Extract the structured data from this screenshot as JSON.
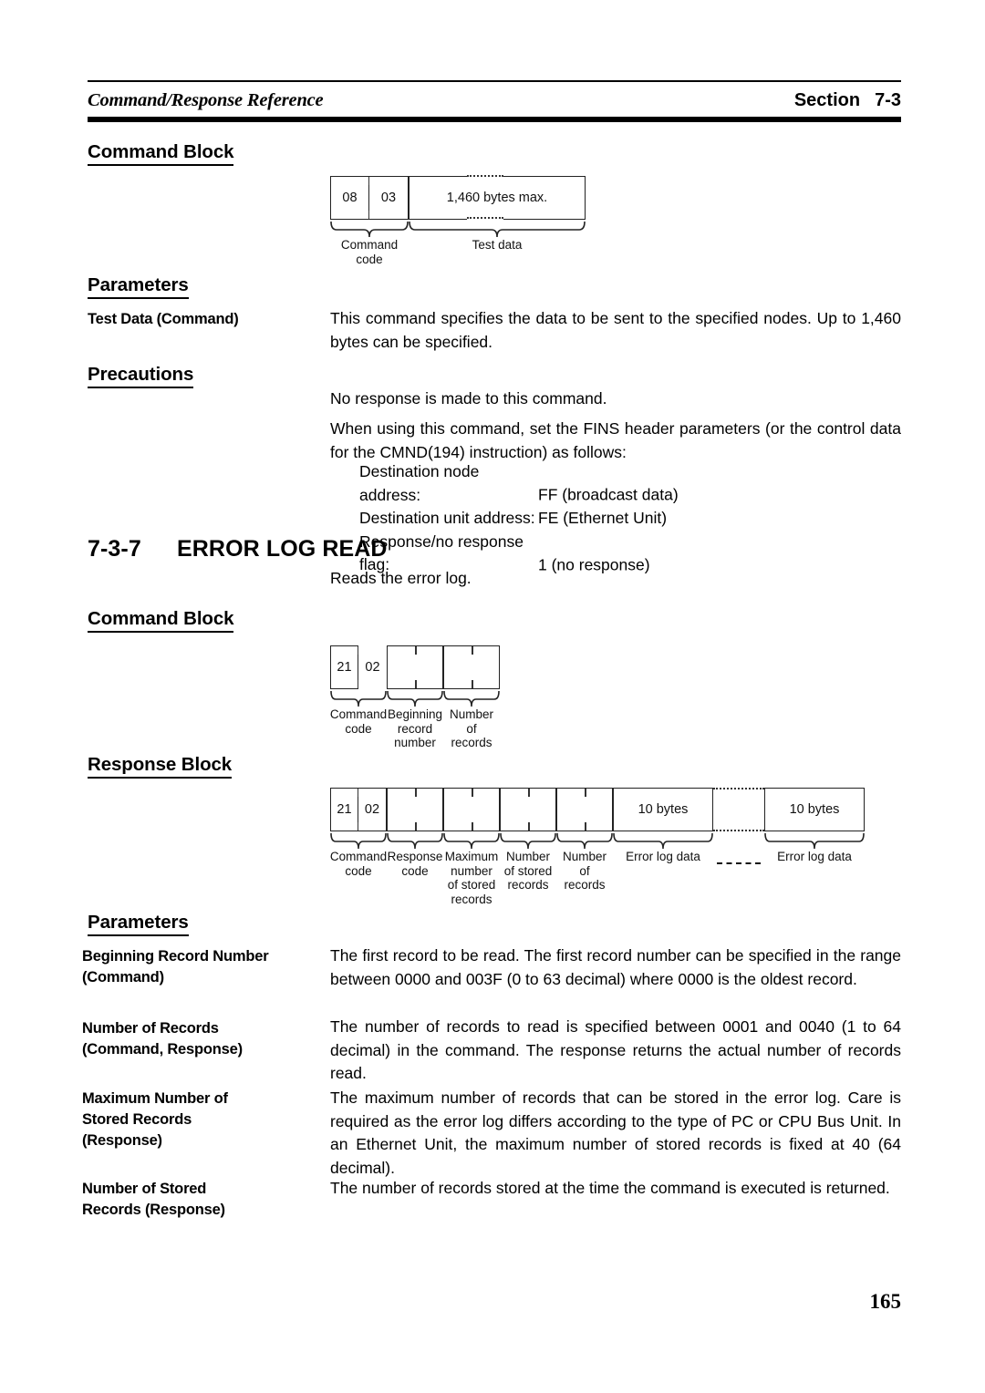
{
  "header": {
    "left_title": "Command/Response Reference",
    "right_label": "Section",
    "right_section": "7-3"
  },
  "folio": "165",
  "sections": {
    "command_block_1_heading": "Command Block",
    "parameters_1_heading": "Parameters",
    "precautions_heading": "Precautions",
    "command_block_2_heading": "Command Block",
    "response_block_heading": "Response Block",
    "parameters_2_heading": "Parameters"
  },
  "diagram_command_1": {
    "cells": [
      {
        "text": "08",
        "label": ""
      },
      {
        "text": "03",
        "label": ""
      },
      {
        "text": "1,460 bytes max.",
        "label": ""
      }
    ],
    "group_labels": [
      "Command\ncode",
      "Test data"
    ],
    "label_command_code_line1": "Command",
    "label_command_code_line2": "code",
    "label_test_data": "Test data",
    "byte1": "08",
    "byte2": "03",
    "test_data_text": "1,460 bytes max."
  },
  "parameters_1": [
    {
      "label": "Test Data (Command)",
      "text": "This command specifies the data to be sent to the specified nodes. Up to 1,460 bytes can be specified."
    }
  ],
  "precautions": {
    "para1": "No response is made to this command.",
    "para2": "When using this command, set the FINS header parameters (or the control data for the CMND(194) instruction) as follows:",
    "settings": [
      {
        "key": "Destination node address:",
        "value": "FF (broadcast data)"
      },
      {
        "key": "Destination unit address:",
        "value": "FE (Ethernet Unit)"
      },
      {
        "key": "Response/no response flag:",
        "value": "1 (no response)"
      }
    ]
  },
  "error_log_read": {
    "number": "7-3-7",
    "title": "ERROR LOG READ",
    "intro": "Reads the error log."
  },
  "diagram_command_2": {
    "byte1": "21",
    "byte2": "02",
    "labels": [
      "Command\ncode",
      "Beginning\nrecord\nnumber",
      "Number\nof\nrecords"
    ],
    "label_command_code": [
      "Command",
      "code"
    ],
    "label_beginning_record_number": [
      "Beginning",
      "record",
      "number"
    ],
    "label_number_of_records": [
      "Number",
      "of",
      "records"
    ]
  },
  "diagram_response": {
    "byte1": "21",
    "byte2": "02",
    "error_log_cell_1": "10 bytes",
    "error_log_cell_2": "10 bytes",
    "label_command_code": [
      "Command",
      "code"
    ],
    "label_response_code": [
      "Response",
      "code"
    ],
    "label_maximum_number_of_stored_records": [
      "Maximum",
      "number",
      "of stored",
      "records"
    ],
    "label_number_of_stored_records": [
      "Number",
      "of stored",
      "records"
    ],
    "label_number_of_records": [
      "Number",
      "of",
      "records"
    ],
    "label_error_log_data_1": "Error log data",
    "label_error_log_data_2": "Error log data"
  },
  "parameters_2": [
    {
      "label_line1": "Beginning Record Number",
      "label_line2": "(Command)",
      "text": "The first record to be read. The first record number can be specified in the range between 0000 and 003F (0 to 63 decimal) where 0000 is the oldest record."
    },
    {
      "label_line1": "Number of Records",
      "label_line2": "(Command, Response)",
      "text": "The number of records to read is specified between 0001 and 0040 (1 to 64 decimal) in the command. The response returns the actual number of records read."
    },
    {
      "label_line1": "Maximum Number of",
      "label_line2": "Stored Records",
      "label_line3": "(Response)",
      "text": "The maximum number of records that can be stored in the error log. Care is required as the error log differs according to the type of PC or CPU Bus Unit. In an Ethernet Unit, the maximum number of stored records is fixed at 40 (64 decimal)."
    },
    {
      "label_line1": "Number of Stored",
      "label_line2": "Records (Response)",
      "text": "The number of records stored at the time the command is executed is returned."
    }
  ]
}
